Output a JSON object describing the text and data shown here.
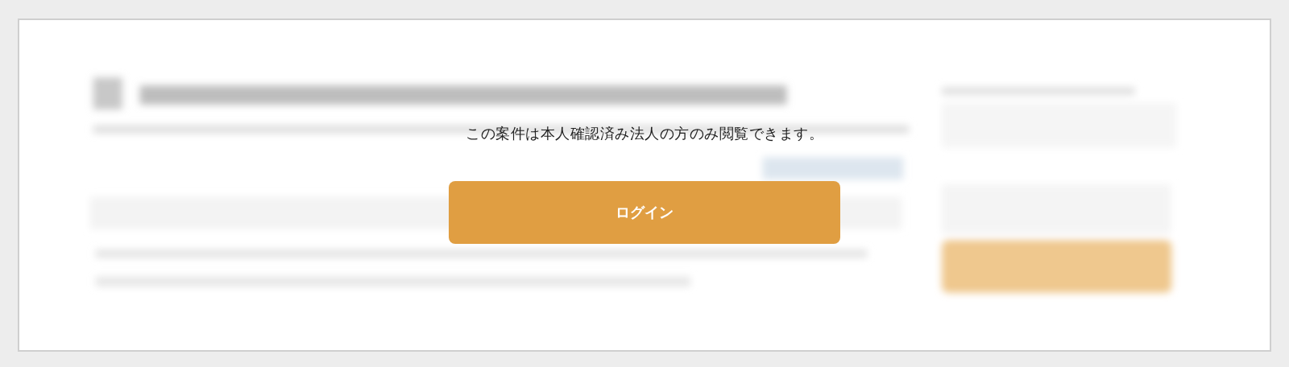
{
  "notice": {
    "message": "この案件は本人確認済み法人の方のみ閲覧できます。"
  },
  "login_button": {
    "label": "ログイン"
  }
}
